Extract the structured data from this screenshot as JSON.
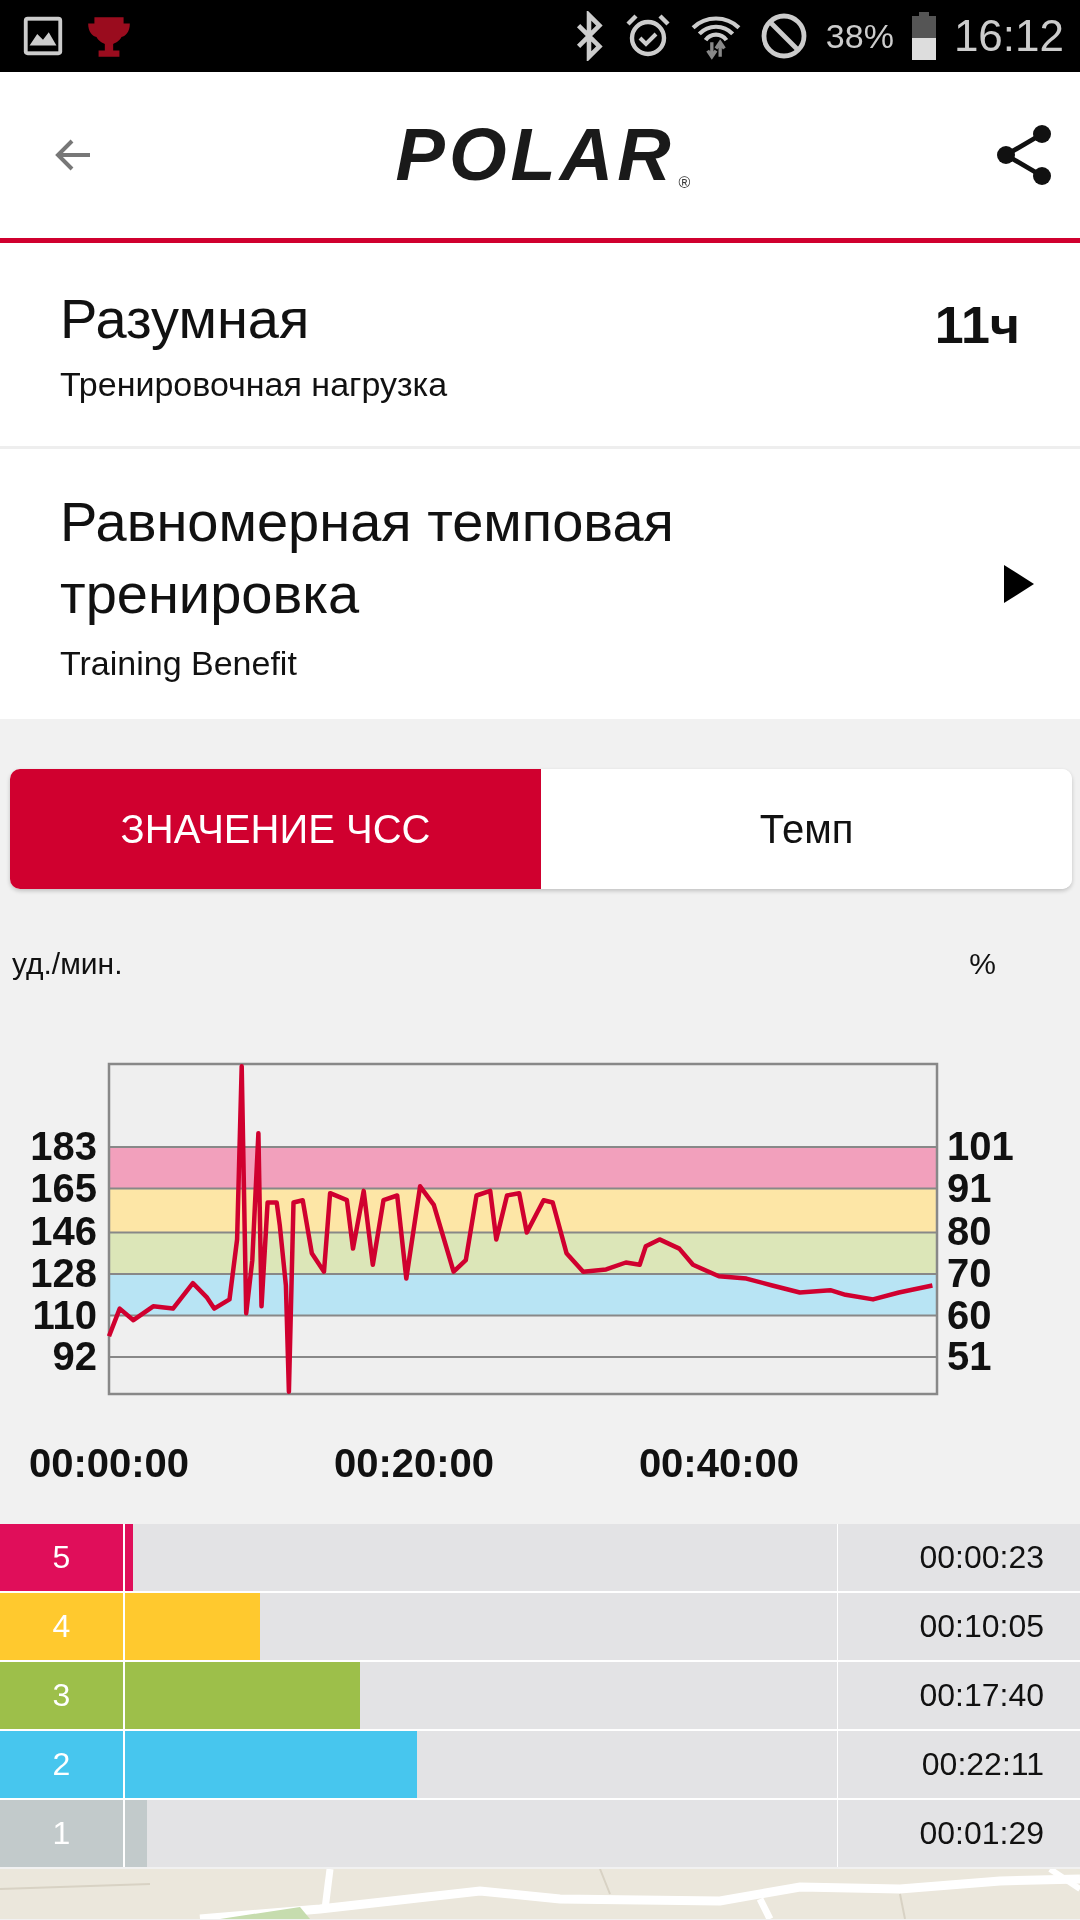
{
  "status_bar": {
    "battery_text": "38%",
    "time": "16:12"
  },
  "header": {
    "logo": "POLAR",
    "logo_mark": "®"
  },
  "training_load": {
    "title": "Разумная",
    "subtitle": "Тренировочная нагрузка",
    "value": "11ч"
  },
  "training_benefit": {
    "title": "Равномерная темповая тренировка",
    "subtitle": "Training Benefit"
  },
  "tabs": [
    {
      "label": "ЗНАЧЕНИЕ ЧСС",
      "selected": true
    },
    {
      "label": "Темп",
      "selected": false
    }
  ],
  "hr_chart": {
    "left_unit": "уд./мин.",
    "right_unit": "%",
    "right_ticks": [
      "101",
      "91",
      "80",
      "70",
      "60",
      "51"
    ],
    "chart_data": {
      "type": "line",
      "xlim": [
        0,
        54.3
      ],
      "ylim": [
        76,
        219
      ],
      "grid": true,
      "bands": [
        {
          "axis": "y",
          "from": 165,
          "to": 183,
          "color": "#f2a0bc"
        },
        {
          "axis": "y",
          "from": 146,
          "to": 165,
          "color": "#fde6a6"
        },
        {
          "axis": "y",
          "from": 128,
          "to": 146,
          "color": "#dce6b8"
        },
        {
          "axis": "y",
          "from": 110,
          "to": 128,
          "color": "#b8e4f4"
        }
      ],
      "xticks": [
        {
          "value": 0,
          "label": "00:00:00"
        },
        {
          "value": 20,
          "label": "00:20:00"
        },
        {
          "value": 40,
          "label": "00:40:00"
        }
      ],
      "yticks": [
        92,
        110,
        128,
        146,
        165,
        183
      ],
      "x": [
        0,
        0.7,
        1.6,
        2.9,
        4.2,
        5.5,
        6.4,
        6.9,
        7.9,
        8.4,
        8.7,
        9.0,
        9.4,
        9.8,
        10.0,
        10.4,
        11.0,
        11.2,
        11.6,
        11.8,
        12.1,
        12.7,
        13.3,
        14.1,
        14.5,
        15.6,
        16.0,
        16.7,
        17.3,
        18.0,
        18.9,
        19.5,
        20.4,
        21.3,
        22.6,
        23.4,
        24.1,
        25.0,
        25.4,
        26.1,
        26.9,
        27.4,
        28.5,
        29.1,
        30.0,
        31.1,
        32.6,
        33.9,
        34.8,
        35.2,
        36.1,
        37.4,
        38.3,
        40.0,
        41.8,
        43.5,
        45.3,
        47.3,
        48.3,
        50.1,
        51.8,
        54.0
      ],
      "series": [
        {
          "color": "#d0002f",
          "values": [
            101,
            113,
            108,
            114,
            113,
            124,
            118,
            113,
            117,
            143,
            218,
            111,
            134,
            189,
            114,
            159,
            159,
            149,
            123,
            77,
            159,
            160,
            137,
            129,
            163,
            160,
            139,
            164,
            132,
            160,
            162,
            126,
            166,
            158,
            129,
            134,
            162,
            164,
            143,
            162,
            163,
            146,
            160,
            159,
            137,
            129,
            130,
            133,
            132,
            140,
            143,
            139,
            132,
            127,
            126,
            123,
            120,
            121,
            119,
            117,
            120,
            123
          ]
        }
      ]
    }
  },
  "zones": [
    {
      "number": "5",
      "time": "00:00:23",
      "level": 0.011,
      "color": "#e00e5a"
    },
    {
      "number": "4",
      "time": "00:10:05",
      "level": 0.19,
      "color": "#ffc92e"
    },
    {
      "number": "3",
      "time": "00:17:40",
      "level": 0.33,
      "color": "#9dbf4a"
    },
    {
      "number": "2",
      "time": "00:22:11",
      "level": 0.41,
      "color": "#47c6ee"
    },
    {
      "number": "1",
      "time": "00:01:29",
      "level": 0.031,
      "color": "#c2cacb"
    }
  ]
}
